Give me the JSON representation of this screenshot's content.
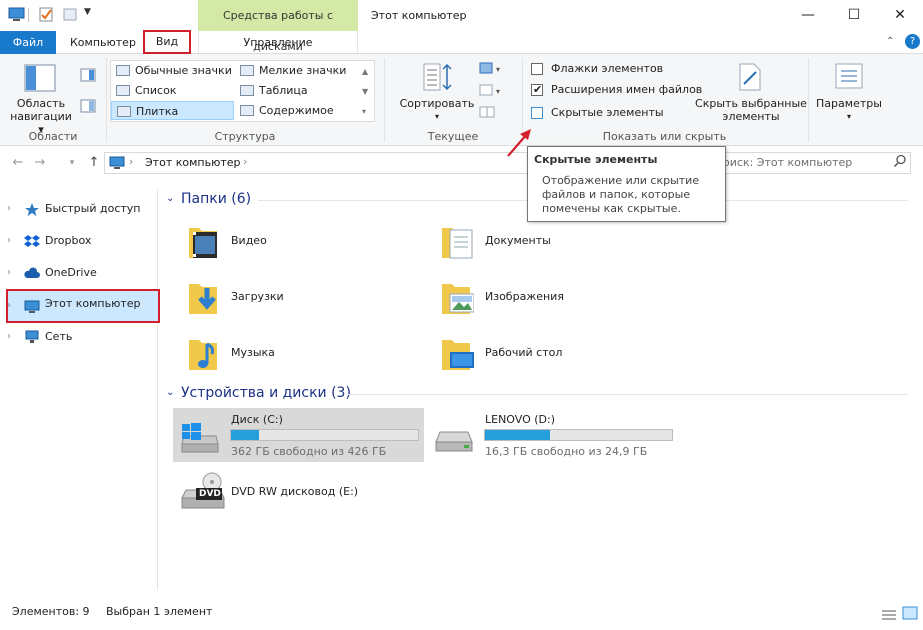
{
  "window": {
    "title": "Этот компьютер",
    "tools_header": "Средства работы с дисками",
    "minimize": "—",
    "maximize": "☐",
    "close": "✕"
  },
  "tabs": {
    "file": "Файл",
    "computer": "Компьютер",
    "view": "Вид",
    "manage": "Управление"
  },
  "ribbon": {
    "panes": {
      "nav_pane_label": "Область навигации",
      "nav_pane_label_line1": "Область",
      "nav_pane_label_line2": "навигации",
      "group_label": "Области"
    },
    "layout": {
      "items": [
        {
          "label": "Обычные значки"
        },
        {
          "label": "Мелкие значки"
        },
        {
          "label": "Список"
        },
        {
          "label": "Таблица"
        },
        {
          "label": "Плитка",
          "selected": true
        },
        {
          "label": "Содержимое"
        }
      ],
      "group_label": "Структура"
    },
    "current_view": {
      "sort_label": "Сортировать",
      "group_label": "Текущее представление"
    },
    "show_hide": {
      "checkboxes": [
        {
          "label": "Флажки элементов",
          "checked": false
        },
        {
          "label": "Расширения имен файлов",
          "checked": true
        },
        {
          "label": "Скрытые элементы",
          "checked": false
        }
      ],
      "hide_selected_line1": "Скрыть выбранные",
      "hide_selected_line2": "элементы",
      "group_label": "Показать или скрыть"
    },
    "options_label": "Параметры"
  },
  "address": {
    "path": "Этот компьютер",
    "search_placeholder": "оиск: Этот компьютер"
  },
  "tooltip": {
    "title": "Скрытые элементы",
    "body": "Отображение или скрытие файлов и папок, которые помечены как скрытые."
  },
  "nav": {
    "items": [
      {
        "label": "Быстрый доступ"
      },
      {
        "label": "Dropbox"
      },
      {
        "label": "OneDrive"
      },
      {
        "label": "Этот компьютер",
        "selected": true
      },
      {
        "label": "Сеть"
      }
    ]
  },
  "content": {
    "folders_header": "Папки (6)",
    "folders": [
      {
        "label": "Видео"
      },
      {
        "label": "Документы"
      },
      {
        "label": "Загрузки"
      },
      {
        "label": "Изображения"
      },
      {
        "label": "Музыка"
      },
      {
        "label": "Рабочий стол"
      }
    ],
    "drives_header": "Устройства и диски (3)",
    "drives": [
      {
        "label": "Диск (C:)",
        "free_text": "362 ГБ свободно из 426 ГБ",
        "used_fraction": 0.15
      },
      {
        "label": "LENOVO (D:)",
        "free_text": "16,3 ГБ свободно из 24,9 ГБ",
        "used_fraction": 0.35
      },
      {
        "label": "DVD RW дисковод (E:)",
        "badge": "DVD"
      }
    ]
  },
  "status": {
    "count": "Элементов: 9",
    "selected": "Выбран 1 элемент"
  },
  "colors": {
    "accent": "#1979ca",
    "highlight_red": "#d21f2c",
    "selection": "#cce8ff",
    "tools_green": "#d4e9a6",
    "progress": "#26a0da"
  }
}
